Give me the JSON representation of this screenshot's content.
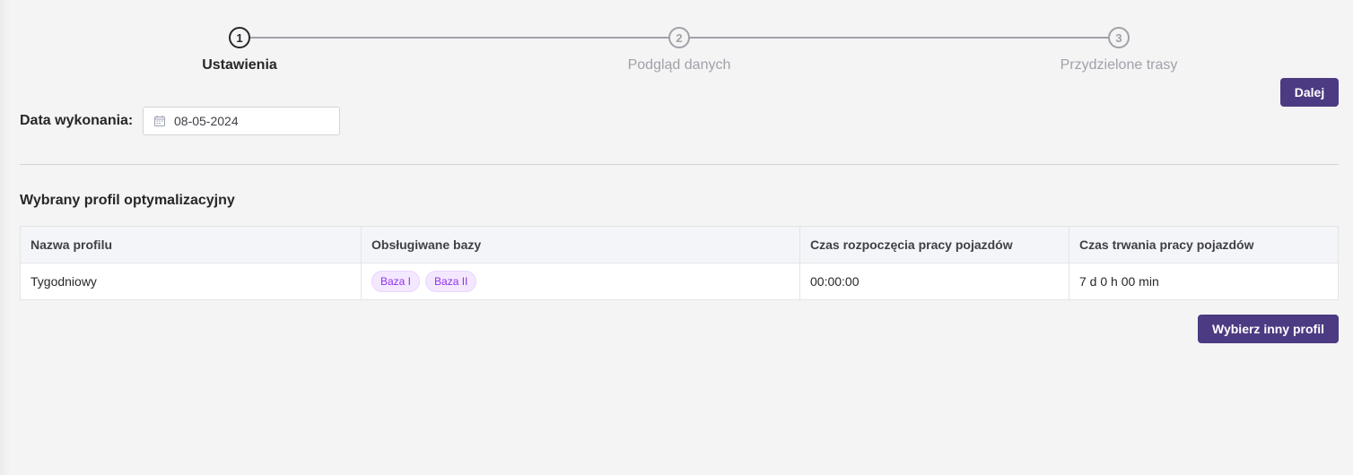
{
  "stepper": {
    "steps": [
      {
        "number": "1",
        "label": "Ustawienia"
      },
      {
        "number": "2",
        "label": "Podgląd danych"
      },
      {
        "number": "3",
        "label": "Przydzielone trasy"
      }
    ]
  },
  "actions": {
    "next_label": "Dalej",
    "change_profile_label": "Wybierz inny profil"
  },
  "form": {
    "date_label": "Data wykonania:",
    "date_value": "08-05-2024"
  },
  "profile_section": {
    "title": "Wybrany profil optymalizacyjny",
    "columns": [
      "Nazwa profilu",
      "Obsługiwane bazy",
      "Czas rozpoczęcia pracy pojazdów",
      "Czas trwania pracy pojazdów"
    ],
    "row": {
      "name": "Tygodniowy",
      "bases": [
        "Baza I",
        "Baza II"
      ],
      "start_time": "00:00:00",
      "duration": "7 d 0 h 00 min"
    }
  },
  "colors": {
    "primary": "#4c3a82",
    "badge_text": "#9333ea",
    "badge_bg": "#f3e8ff"
  }
}
